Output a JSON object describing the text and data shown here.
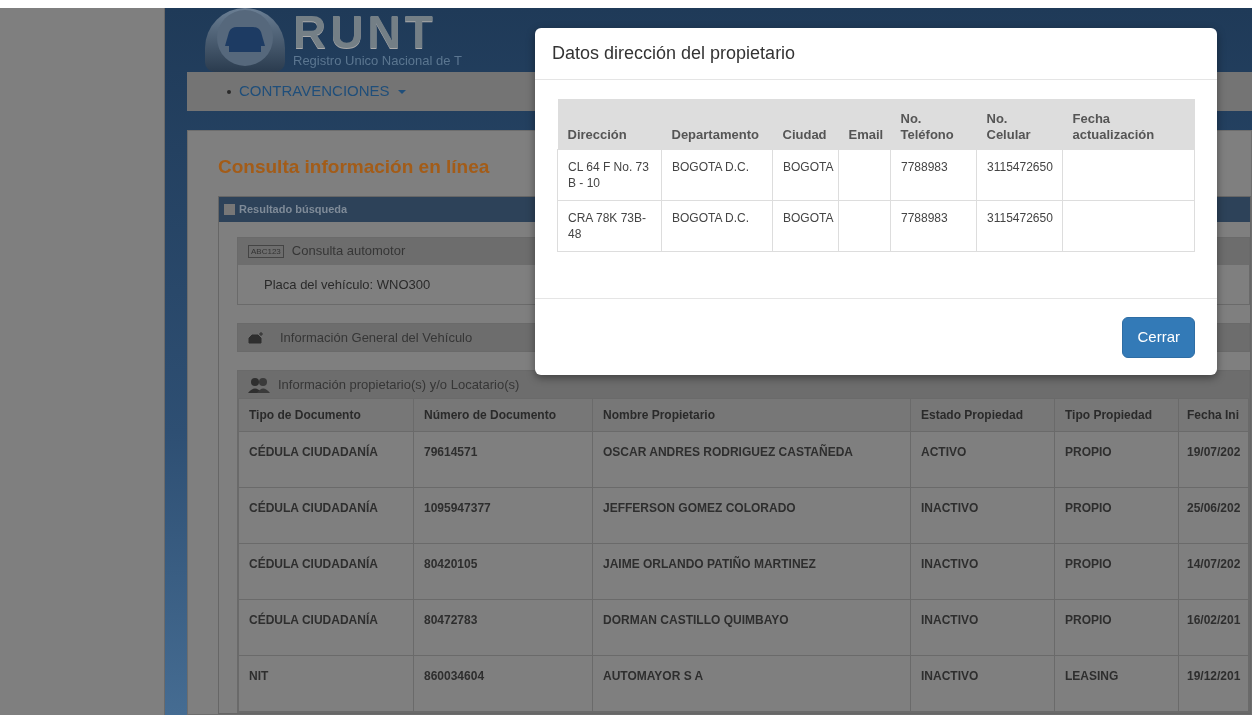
{
  "header": {
    "logo_text": "RUNT",
    "logo_subtitle": "Registro Unico Nacional de T"
  },
  "nav": {
    "items": [
      {
        "label": "CONTRAVENCIONES",
        "dropdown": true
      }
    ]
  },
  "page_title": "Consulta información en línea",
  "results_panel": {
    "title": "Resultado búsqueda",
    "sections": [
      {
        "kind": "plate",
        "title": "Consulta automotor",
        "icon_text": "ABC123",
        "body": "Placa del vehículo: WNO300"
      },
      {
        "kind": "vehicle",
        "title": "Información General del Vehículo"
      },
      {
        "kind": "owners",
        "title": "Información propietario(s) y/o Locatario(s)",
        "table": {
          "columns": [
            "Tipo de Documento",
            "Número de Documento",
            "Nombre Propietario",
            "Estado Propiedad",
            "Tipo Propiedad",
            "Fecha Ini"
          ],
          "rows": [
            [
              "CÉDULA CIUDADANÍA",
              "79614571",
              "OSCAR ANDRES RODRIGUEZ CASTAÑEDA",
              "ACTIVO",
              "PROPIO",
              "19/07/202"
            ],
            [
              "CÉDULA CIUDADANÍA",
              "1095947377",
              "JEFFERSON GOMEZ COLORADO",
              "INACTIVO",
              "PROPIO",
              "25/06/202"
            ],
            [
              "CÉDULA CIUDADANÍA",
              "80420105",
              "JAIME ORLANDO PATIÑO MARTINEZ",
              "INACTIVO",
              "PROPIO",
              "14/07/202"
            ],
            [
              "CÉDULA CIUDADANÍA",
              "80472783",
              "DORMAN CASTILLO QUIMBAYO",
              "INACTIVO",
              "PROPIO",
              "16/02/201"
            ],
            [
              "NIT",
              "860034604",
              "AUTOMAYOR S A",
              "INACTIVO",
              "LEASING",
              "19/12/201"
            ]
          ]
        }
      }
    ]
  },
  "modal": {
    "title": "Datos dirección del propietario",
    "table": {
      "columns": [
        "Dirección",
        "Departamento",
        "Ciudad",
        "Email",
        "No. Teléfono",
        "No. Celular",
        "Fecha actualización"
      ],
      "rows": [
        [
          "CL 64 F No. 73 B - 10",
          "BOGOTA D.C.",
          "BOGOTA",
          null,
          "7788983",
          "3115472650",
          null
        ],
        [
          "CRA 78K 73B-48",
          "BOGOTA D.C.",
          "BOGOTA",
          null,
          "7788983",
          "3115472650",
          null
        ]
      ]
    },
    "buttons": [
      "Cerrar"
    ]
  }
}
